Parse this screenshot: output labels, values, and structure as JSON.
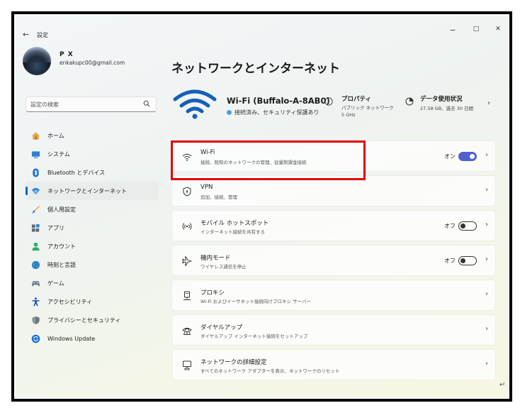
{
  "window": {
    "title": "設定",
    "back_glyph": "←",
    "minimize_glyph": "−",
    "maximize_glyph": "□",
    "close_glyph": "✕"
  },
  "profile": {
    "name": "P X",
    "email": "enkakupc00@gmail.com"
  },
  "search": {
    "placeholder": "設定の検索"
  },
  "sidebar": {
    "items": [
      {
        "label": "ホーム",
        "icon": "home-icon",
        "active": false
      },
      {
        "label": "システム",
        "icon": "system-icon",
        "active": false
      },
      {
        "label": "Bluetooth とデバイス",
        "icon": "bluetooth-icon",
        "active": false
      },
      {
        "label": "ネットワークとインターネット",
        "icon": "network-icon",
        "active": true
      },
      {
        "label": "個人用設定",
        "icon": "brush-icon",
        "active": false
      },
      {
        "label": "アプリ",
        "icon": "apps-icon",
        "active": false
      },
      {
        "label": "アカウント",
        "icon": "account-icon",
        "active": false
      },
      {
        "label": "時刻と言語",
        "icon": "globe-clock-icon",
        "active": false
      },
      {
        "label": "ゲーム",
        "icon": "gamepad-icon",
        "active": false
      },
      {
        "label": "アクセシビリティ",
        "icon": "accessibility-icon",
        "active": false
      },
      {
        "label": "プライバシーとセキュリティ",
        "icon": "shield-icon",
        "active": false
      },
      {
        "label": "Windows Update",
        "icon": "windows-update-icon",
        "active": false
      }
    ]
  },
  "main": {
    "title": "ネットワークとインターネット",
    "hero": {
      "network_name": "Wi-Fi (Buffalo-A-8AB0)",
      "status": "接続済み、セキュリティ保護あり",
      "properties_title": "プロパティ",
      "properties_sub1": "パブリック ネットワーク",
      "properties_sub2": "5 GHz",
      "data_title": "データ使用状況",
      "data_sub": "27.58 GB、過去 30 日間",
      "chevron": "›"
    },
    "rows": [
      {
        "title": "Wi-Fi",
        "sub": "接続、既知のネットワークの管理、従量制課金接続",
        "icon": "wifi-icon",
        "toggle": "オン"
      },
      {
        "title": "VPN",
        "sub": "追加、接続、管理",
        "icon": "vpn-shield-icon"
      },
      {
        "title": "モバイル ホットスポット",
        "sub": "インターネット接続を共有する",
        "icon": "hotspot-icon",
        "toggle": "オフ"
      },
      {
        "title": "機内モード",
        "sub": "ワイヤレス通信を停止",
        "icon": "airplane-icon",
        "toggle": "オフ"
      },
      {
        "title": "プロキシ",
        "sub": "Wi-Fi およびイーサネット接続向けプロキシ サーバー",
        "icon": "proxy-icon"
      },
      {
        "title": "ダイヤルアップ",
        "sub": "ダイヤルアップ インターネット接続をセットアップ",
        "icon": "dialup-icon"
      },
      {
        "title": "ネットワークの詳細設定",
        "sub": "すべてのネットワーク アダプターを表示、ネットワークのリセット",
        "icon": "network-pc-icon"
      }
    ],
    "chevron": "›"
  },
  "colors": {
    "accent": "#5060d0",
    "highlight": "#e00000",
    "active_indicator": "#1060c0"
  }
}
